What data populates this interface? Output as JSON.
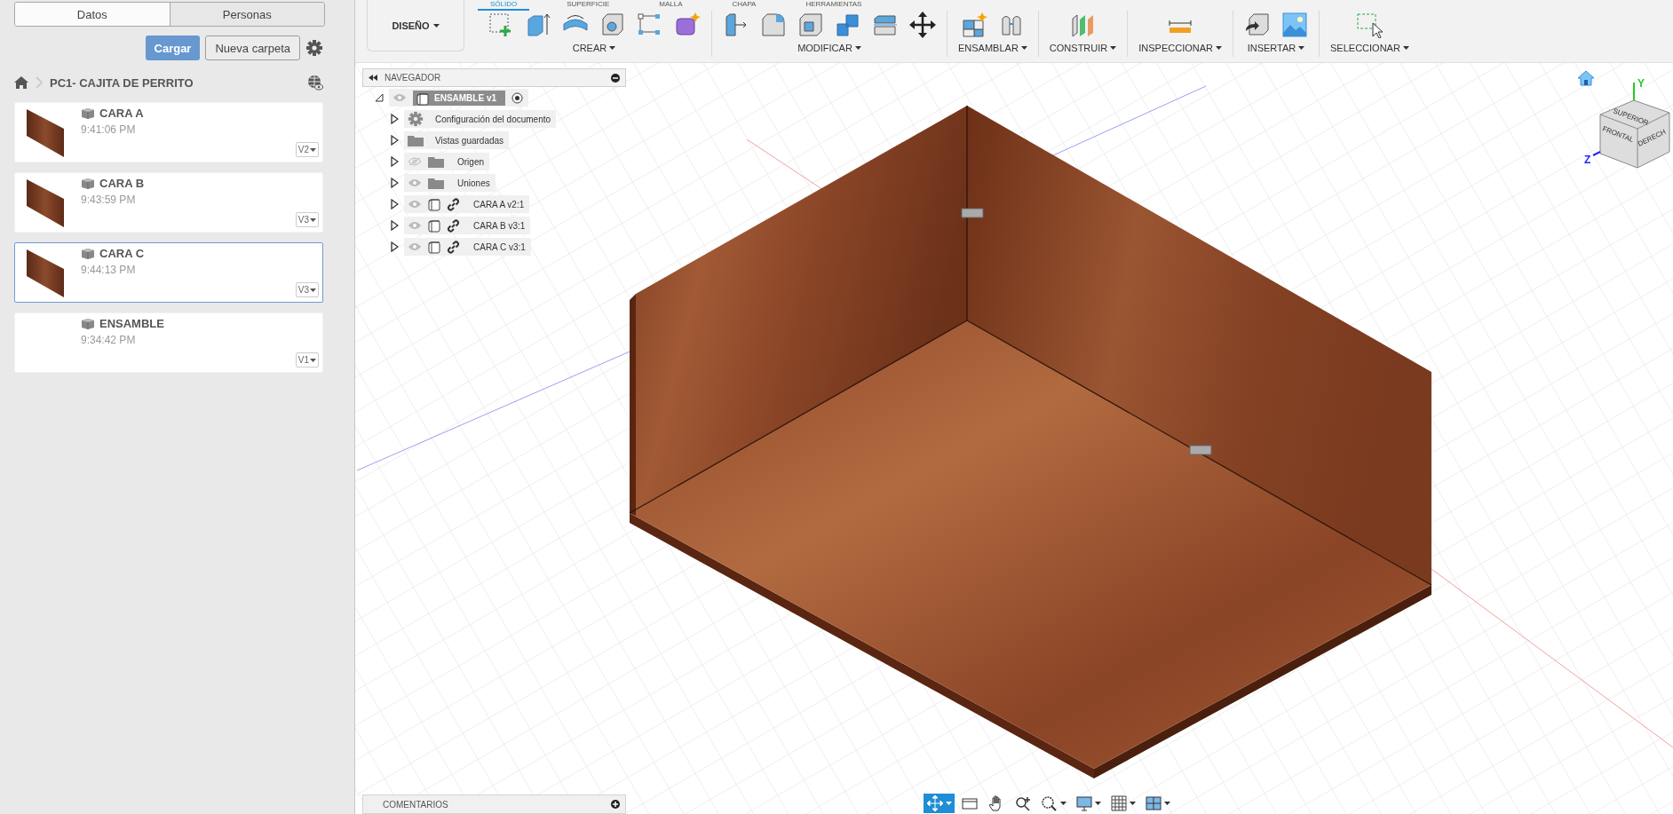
{
  "data_panel": {
    "tabs": [
      {
        "label": "Datos",
        "selected": true
      },
      {
        "label": "Personas",
        "selected": false
      }
    ],
    "upload_button": "Cargar",
    "new_folder_button": "Nueva carpeta",
    "breadcrumb": "PC1- CAJITA DE PERRITO",
    "files": [
      {
        "name": "CARA A",
        "time": "9:41:06 PM",
        "version": "V2",
        "thumbnail": true,
        "selected": false
      },
      {
        "name": "CARA B",
        "time": "9:43:59 PM",
        "version": "V3",
        "thumbnail": true,
        "selected": false
      },
      {
        "name": "CARA C",
        "time": "9:44:13 PM",
        "version": "V3",
        "thumbnail": true,
        "selected": true
      },
      {
        "name": "ENSAMBLE",
        "time": "9:34:42 PM",
        "version": "V1",
        "thumbnail": false,
        "selected": false
      }
    ]
  },
  "toolbar": {
    "workspace": "DISEÑO",
    "tabs": [
      {
        "label": "SÓLIDO",
        "selected": true
      },
      {
        "label": "SUPERFICIE",
        "selected": false
      },
      {
        "label": "MALLA",
        "selected": false
      },
      {
        "label": "CHAPA",
        "selected": false
      },
      {
        "label": "HERRAMIENTAS",
        "selected": false
      }
    ],
    "groups": [
      "CREAR",
      "MODIFICAR",
      "ENSAMBLAR",
      "CONSTRUIR",
      "INSPECCIONAR",
      "INSERTAR",
      "SELECCIONAR"
    ]
  },
  "navigator": {
    "title": "NAVEGADOR",
    "root": {
      "label": "ENSAMBLE v1",
      "expanded": true,
      "visible": true,
      "children": [
        {
          "kind": "settings",
          "label": "Configuración del documento"
        },
        {
          "kind": "folder",
          "label": "Vistas guardadas"
        },
        {
          "kind": "folder",
          "label": "Origen",
          "visible": false
        },
        {
          "kind": "folder",
          "label": "Uniones",
          "visible": true
        },
        {
          "kind": "component",
          "label": "CARA A v2:1",
          "visible": true
        },
        {
          "kind": "component",
          "label": "CARA B v3:1",
          "visible": true
        },
        {
          "kind": "component",
          "label": "CARA C v3:1",
          "visible": true
        }
      ]
    }
  },
  "view_cube": {
    "top": "SUPERIOR",
    "front": "FRONTAL",
    "right": "DERECH",
    "y_axis": "Y",
    "z_axis": "Z"
  },
  "comments_panel": {
    "title": "COMENTARIOS"
  },
  "nav_tools": [
    {
      "kind": "orbit",
      "selected": true
    },
    {
      "kind": "look",
      "selected": false
    },
    {
      "kind": "pan",
      "selected": false
    },
    {
      "kind": "zoom",
      "selected": false
    },
    {
      "kind": "fit",
      "selected": false
    },
    {
      "kind": "display",
      "selected": false
    },
    {
      "kind": "grid",
      "selected": false
    },
    {
      "kind": "viewports",
      "selected": false
    }
  ]
}
